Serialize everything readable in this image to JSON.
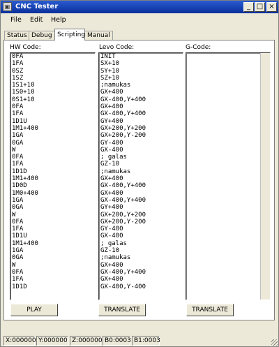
{
  "window": {
    "title": "CNC Tester",
    "icon": "app-icon"
  },
  "menu": [
    "File",
    "Edit",
    "Help"
  ],
  "tabs": [
    {
      "label": "Status"
    },
    {
      "label": "Debug"
    },
    {
      "label": "Scripting",
      "active": true
    },
    {
      "label": "Manual"
    }
  ],
  "columns": {
    "hw": {
      "label": "HW Code:",
      "lines": [
        "0FA",
        "1FA",
        "0SZ",
        "1SZ",
        "1S1+10",
        "1S0+10",
        "0S1+10",
        "0FA",
        "1FA",
        "1D1U",
        "1M1+400",
        "1GA",
        "0GA",
        "W",
        "0FA",
        "1FA",
        "1D1D",
        "1M1+400",
        "1D0D",
        "1M0+400",
        "1GA",
        "0GA",
        "W",
        "0FA",
        "1FA",
        "1D1U",
        "1M1+400",
        "1GA",
        "0GA",
        "W",
        "0FA",
        "1FA",
        "1D1D"
      ]
    },
    "levo": {
      "label": "Levo Code:",
      "lines": [
        "INIT",
        "SX+10",
        "SY+10",
        "SZ+10",
        ";namukas",
        "GX+400",
        "GX-400,Y+400",
        "GX+400",
        "GX-400,Y+400",
        "GY+400",
        "GX+200,Y+200",
        "GX+200,Y-200",
        "GY-400",
        "GX-400",
        "; galas",
        "GZ-10",
        ";namukas",
        "GX+400",
        "GX-400,Y+400",
        "GX+400",
        "GX-400,Y+400",
        "GY+400",
        "GX+200,Y+200",
        "GX+200,Y-200",
        "GY-400",
        "GX-400",
        "; galas",
        "GZ-10",
        ";namukas",
        "GX+400",
        "GX-400,Y+400",
        "GX+400",
        "GX-400,Y-400"
      ]
    },
    "gcode": {
      "label": "G-Code:",
      "lines": []
    }
  },
  "buttons": {
    "play": "PLAY",
    "translate1": "TRANSLATE",
    "translate2": "TRANSLATE"
  },
  "status": [
    "X:000000",
    "Y:000000",
    "Z:000000",
    "B0:0003",
    "B1:0003"
  ]
}
